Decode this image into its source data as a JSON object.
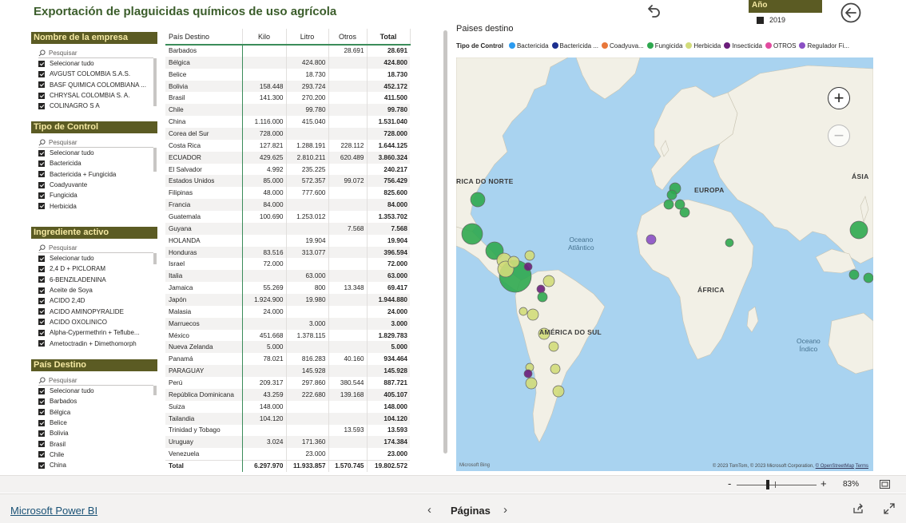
{
  "report": {
    "title": "Exportación de plaguicidas químicos de uso agrícola"
  },
  "year_slicer": {
    "header": "Año",
    "item": "2019"
  },
  "slicers": [
    {
      "header": "Nombre de la empresa",
      "search": "Pesquisar",
      "items": [
        "Selecionar tudo",
        "AVGUST COLOMBIA S.A.S.",
        "BASF QUIMICA COLOMBIANA ...",
        "CHRYSAL COLOMBIA S. A.",
        "COLINAGRO S A"
      ]
    },
    {
      "header": "Tipo de Control",
      "search": "Pesquisar",
      "items": [
        "Selecionar tudo",
        "Bactericida",
        "Bactericida + Fungicida",
        "Coadyuvante",
        "Fungicida",
        "Herbicida"
      ]
    },
    {
      "header": "Ingrediente activo",
      "search": "Pesquisar",
      "items": [
        "Selecionar tudo",
        "2,4 D + PICLORAM",
        "6-BENZILADENINA",
        "Aceite de Soya",
        "ACIDO 2,4D",
        "ACIDO AMINOPYRALIDE",
        "ACIDO OXOLINICO",
        "Alpha-Cypermethrin + Teflube...",
        "Ametoctradin + Dimethomorph"
      ]
    },
    {
      "header": "País Destino",
      "search": "Pesquisar",
      "items": [
        "Selecionar tudo",
        "Barbados",
        "Bélgica",
        "Belice",
        "Bolivia",
        "Brasil",
        "Chile",
        "China"
      ]
    }
  ],
  "table": {
    "columns": [
      "País Destino",
      "Kilo",
      "Litro",
      "Otros",
      "Total"
    ],
    "rows": [
      [
        "Barbados",
        "",
        "",
        "28.691",
        "28.691"
      ],
      [
        "Bélgica",
        "",
        "424.800",
        "",
        "424.800"
      ],
      [
        "Belice",
        "",
        "18.730",
        "",
        "18.730"
      ],
      [
        "Bolivia",
        "158.448",
        "293.724",
        "",
        "452.172"
      ],
      [
        "Brasil",
        "141.300",
        "270.200",
        "",
        "411.500"
      ],
      [
        "Chile",
        "",
        "99.780",
        "",
        "99.780"
      ],
      [
        "China",
        "1.116.000",
        "415.040",
        "",
        "1.531.040"
      ],
      [
        "Corea del Sur",
        "728.000",
        "",
        "",
        "728.000"
      ],
      [
        "Costa Rica",
        "127.821",
        "1.288.191",
        "228.112",
        "1.644.125"
      ],
      [
        "ECUADOR",
        "429.625",
        "2.810.211",
        "620.489",
        "3.860.324"
      ],
      [
        "El Salvador",
        "4.992",
        "235.225",
        "",
        "240.217"
      ],
      [
        "Estados Unidos",
        "85.000",
        "572.357",
        "99.072",
        "756.429"
      ],
      [
        "Filipinas",
        "48.000",
        "777.600",
        "",
        "825.600"
      ],
      [
        "Francia",
        "84.000",
        "",
        "",
        "84.000"
      ],
      [
        "Guatemala",
        "100.690",
        "1.253.012",
        "",
        "1.353.702"
      ],
      [
        "Guyana",
        "",
        "",
        "7.568",
        "7.568"
      ],
      [
        "HOLANDA",
        "",
        "19.904",
        "",
        "19.904"
      ],
      [
        "Honduras",
        "83.516",
        "313.077",
        "",
        "396.594"
      ],
      [
        "Israel",
        "72.000",
        "",
        "",
        "72.000"
      ],
      [
        "Italia",
        "",
        "63.000",
        "",
        "63.000"
      ],
      [
        "Jamaica",
        "55.269",
        "800",
        "13.348",
        "69.417"
      ],
      [
        "Japón",
        "1.924.900",
        "19.980",
        "",
        "1.944.880"
      ],
      [
        "Malasia",
        "24.000",
        "",
        "",
        "24.000"
      ],
      [
        "Marruecos",
        "",
        "3.000",
        "",
        "3.000"
      ],
      [
        "México",
        "451.668",
        "1.378.115",
        "",
        "1.829.783"
      ],
      [
        "Nueva Zelanda",
        "5.000",
        "",
        "",
        "5.000"
      ],
      [
        "Panamá",
        "78.021",
        "816.283",
        "40.160",
        "934.464"
      ],
      [
        "PARAGUAY",
        "",
        "145.928",
        "",
        "145.928"
      ],
      [
        "Perú",
        "209.317",
        "297.860",
        "380.544",
        "887.721"
      ],
      [
        "República Dominicana",
        "43.259",
        "222.680",
        "139.168",
        "405.107"
      ],
      [
        "Suiza",
        "148.000",
        "",
        "",
        "148.000"
      ],
      [
        "Tailandia",
        "104.120",
        "",
        "",
        "104.120"
      ],
      [
        "Trinidad y Tobago",
        "",
        "",
        "13.593",
        "13.593"
      ],
      [
        "Uruguay",
        "3.024",
        "171.360",
        "",
        "174.384"
      ],
      [
        "Venezuela",
        "",
        "23.000",
        "",
        "23.000"
      ]
    ],
    "total": [
      "Total",
      "6.297.970",
      "11.933.857",
      "1.570.745",
      "19.802.572"
    ]
  },
  "map": {
    "title": "Paises destino",
    "legend_title": "Tipo de Control",
    "legend": [
      {
        "label": "Bactericida",
        "color": "#2b9bf0"
      },
      {
        "label": "Bactericida ...",
        "color": "#1c2f8f"
      },
      {
        "label": "Coadyuva...",
        "color": "#e8773a"
      },
      {
        "label": "Fungicida",
        "color": "#2fa84f"
      },
      {
        "label": "Herbicida",
        "color": "#d2dc7a"
      },
      {
        "label": "Insecticida",
        "color": "#6b1d7a"
      },
      {
        "label": "OTROS",
        "color": "#e14b9f"
      },
      {
        "label": "Regulador Fi...",
        "color": "#8a4fc4"
      }
    ],
    "labels": {
      "north_america": "RICA DO NORTE",
      "europe": "EUROPA",
      "asia": "ÁSIA",
      "africa": "ÁFRICA",
      "south_america": "AMÉRICA DO SUL",
      "atlantic": "Oceano\nAtlântico",
      "indian": "Oceano\nÍndico"
    },
    "copyright_prefix": "© 2023 TomTom, © 2023 Microsoft Corporation,",
    "copyright_osm": "© OpenStreetMap",
    "copyright_terms": "Terms",
    "bing": "Microsoft Bing"
  },
  "zoom": {
    "percent": "83%",
    "minus": "-",
    "plus": "+"
  },
  "footer": {
    "brand": "Microsoft Power BI",
    "pages": "Páginas"
  }
}
